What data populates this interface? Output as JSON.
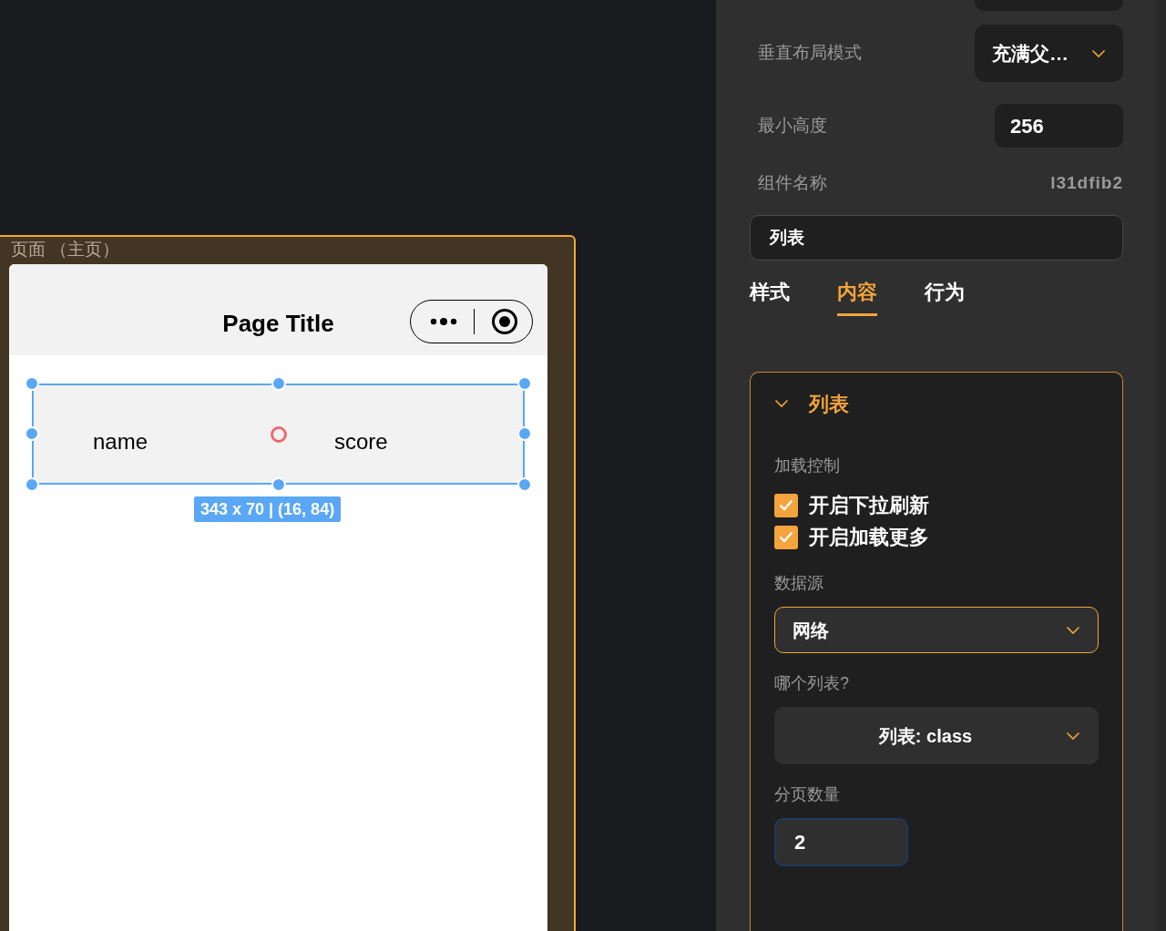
{
  "canvas": {
    "page_label": "页面 （主页）",
    "phone": {
      "title": "Page Title",
      "list_item": {
        "selected": true,
        "fields": [
          "name",
          "score"
        ],
        "size_label": "343 x 70 | (16, 84)"
      }
    }
  },
  "properties": [
    {
      "kind": "select",
      "label": "垂直布局模式",
      "value": "充满父…"
    },
    {
      "kind": "input",
      "label": "最小高度",
      "value": "256"
    },
    {
      "kind": "text",
      "label": "组件名称",
      "value": "l31dfib2"
    }
  ],
  "name_field": {
    "value": "列表"
  },
  "tabs": [
    {
      "label": "样式",
      "selected": false
    },
    {
      "label": "内容",
      "selected": true
    },
    {
      "label": "行为",
      "selected": false
    }
  ],
  "section": {
    "title": "列表",
    "expanded": true,
    "items": [
      {
        "kind": "heading",
        "label": "加载控制"
      },
      {
        "kind": "checkbox",
        "label": "开启下拉刷新",
        "checked": true
      },
      {
        "kind": "checkbox",
        "label": "开启加载更多",
        "checked": true
      },
      {
        "kind": "heading",
        "label": "数据源"
      },
      {
        "kind": "select",
        "value": "网络",
        "active": true,
        "centered": false
      },
      {
        "kind": "heading",
        "label": "哪个列表?"
      },
      {
        "kind": "select",
        "value": "列表: class",
        "active": false,
        "centered": true
      },
      {
        "kind": "heading",
        "label": "分页数量"
      },
      {
        "kind": "input",
        "value": "2",
        "focused": true
      }
    ]
  }
}
